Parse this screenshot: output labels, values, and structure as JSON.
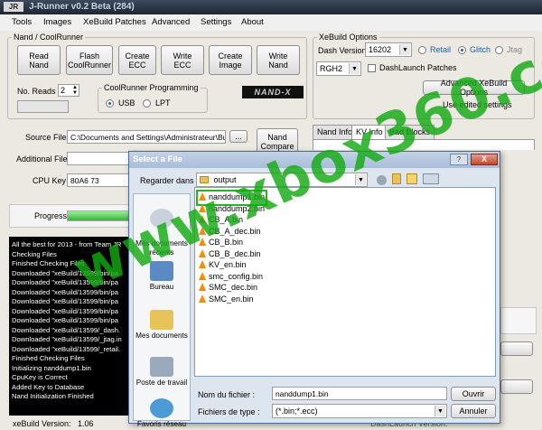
{
  "window": {
    "title": "J-Runner v0.2 Beta (284)",
    "logo_text": "JR"
  },
  "menu": [
    "Tools",
    "Images",
    "XeBuild Patches",
    "Advanced",
    "Settings",
    "About"
  ],
  "nand_coolrunner": {
    "legend": "Nand / CoolRunner",
    "buttons": [
      "Read\nNand",
      "Flash\nCoolRunner",
      "Create\nECC",
      "Write ECC",
      "Create\nImage",
      "Write\nNand"
    ],
    "no_reads_label": "No. Reads",
    "no_reads_value": "2"
  },
  "coolrunner_programming": {
    "legend": "CoolRunner Programming",
    "usb_label": "USB",
    "lpt_label": "LPT",
    "selected": "USB"
  },
  "nandx_logo": "NAND-X",
  "xebuild": {
    "legend": "XeBuild Options",
    "dash_label": "Dash Version",
    "dash_value": "16202",
    "retail_label": "Retail",
    "glitch_label": "Glitch",
    "jtag_label": "Jtag",
    "selected_mode": "Glitch",
    "rgh_value": "RGH2",
    "dashlaunch_label": "DashLaunch Patches",
    "advanced_button": "Advanced XeBuild Options",
    "edited_settings": "Use edited settings"
  },
  "files": {
    "source_label": "Source File",
    "source_value": "C:\\Documents and Settings\\Administrateur\\Bureau",
    "browse_label": "...",
    "additional_label": "Additional File",
    "cpukey_label": "CPU Key",
    "cpukey_value": "80A6                  73",
    "nand_compare_button": "Nand\nCompare"
  },
  "tabs": [
    "Nand Info",
    "KV Info",
    "Bad Blocks"
  ],
  "active_tab": "KV Info",
  "progress": {
    "label": "Progress",
    "fraction": 0.95
  },
  "log": [
    "All the best for 2013 -  from Team JR",
    "Checking Files",
    "Finished Checking Files",
    "Downloaded \"xeBuild/13599/bin/pa",
    "Downloaded \"xeBuild/13599/bin/pa",
    "Downloaded \"xeBuild/13599/bin/pa",
    "Downloaded \"xeBuild/13599/bin/pa",
    "Downloaded \"xeBuild/13599/bin/pa",
    "Downloaded \"xeBuild/13599/bin/pa",
    "Downloaded \"xeBuild/13599/_dash.",
    "Downloaded \"xeBuild/13599/_jtag.in",
    "Downloaded \"xeBuild/13599/_retail.",
    "Finished Checking Files",
    "Initializing nanddump1.bin",
    "CpuKey is Correct",
    "Added Key to Database",
    "Nand Initialization Finished"
  ],
  "status": {
    "xebuild_label": "xeBuild Version:",
    "xebuild_value": "1.06",
    "dashlaunch_label": "DashLaunch Version:"
  },
  "dialog": {
    "title": "Select a File",
    "help": "?",
    "close": "X",
    "look_in_label": "Regarder dans :",
    "look_in_value": "output",
    "places": [
      "Mes documents\nrécents",
      "Bureau",
      "Mes documents",
      "Poste de travail",
      "Favoris réseau"
    ],
    "files": [
      "nanddump1.bin",
      "nanddump2.bin",
      "CB_A.bin",
      "CB_A_dec.bin",
      "CB_B.bin",
      "CB_B_dec.bin",
      "KV_en.bin",
      "smc_config.bin",
      "SMC_dec.bin",
      "SMC_en.bin"
    ],
    "selected_file": "nanddump1.bin",
    "filename_label": "Nom du fichier :",
    "filename_value": "nanddump1.bin",
    "filetype_label": "Fichiers de type :",
    "filetype_value": "(*.bin;*.ecc)",
    "open_button": "Ouvrir",
    "cancel_button": "Annuler"
  },
  "watermark": "www.xbox360.com",
  "colors": {
    "progress": "#2eb72e",
    "watermark": "#14aa14",
    "highlight": "#27b327",
    "accent": "#1c5fb0"
  }
}
